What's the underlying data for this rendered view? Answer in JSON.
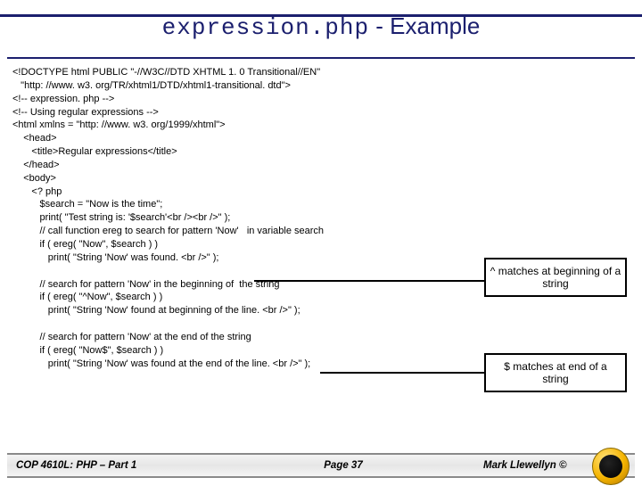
{
  "title_mono": "expression.php",
  "title_rest": " - Example",
  "code": "<!DOCTYPE html PUBLIC \"-//W3C//DTD XHTML 1. 0 Transitional//EN\"\n   \"http: //www. w3. org/TR/xhtml1/DTD/xhtml1-transitional. dtd\">\n<!-- expression. php -->\n<!-- Using regular expressions -->\n<html xmlns = \"http: //www. w3. org/1999/xhtml\">\n    <head>\n       <title>Regular expressions</title>\n    </head>\n    <body>\n       <? php\n          $search = \"Now is the time\";\n          print( \"Test string is: '$search'<br /><br />\" );\n          // call function ereg to search for pattern 'Now'   in variable search\n          if ( ereg( \"Now\", $search ) )\n             print( \"String 'Now' was found. <br />\" );\n\n          // search for pattern 'Now' in the beginning of  the string\n          if ( ereg( \"^Now\", $search ) )\n             print( \"String 'Now' found at beginning of the line. <br />\" );\n\n          // search for pattern 'Now' at the end of the string\n          if ( ereg( \"Now$\", $search ) )\n             print( \"String 'Now' was found at the end of the line. <br />\" );",
  "callout1": "^ matches at beginning of a string",
  "callout2": "$ matches at end of a string",
  "footer": {
    "left": "COP 4610L: PHP – Part 1",
    "center": "Page 37",
    "right": "Mark Llewellyn ©"
  }
}
